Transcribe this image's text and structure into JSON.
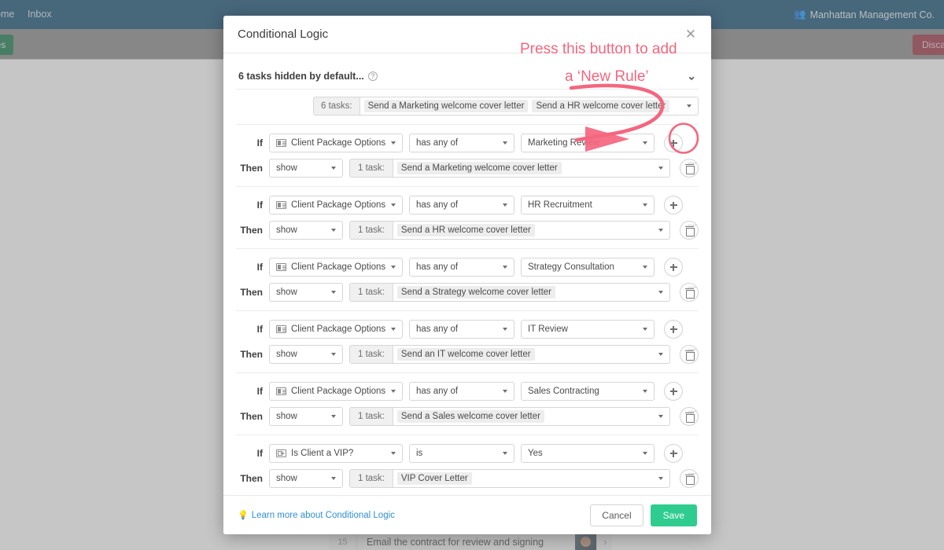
{
  "background": {
    "nav": {
      "home_label": "ome",
      "inbox_label": "Inbox",
      "org_label": "Manhattan Management Co.",
      "org_icon": "users-icon"
    },
    "subbar": {
      "green_button_label": "ges",
      "discard_button_label": "Discar"
    },
    "task_row": {
      "number": "15",
      "label": "Email the contract for review and signing",
      "chevron_icon": "chevron-right-icon",
      "avatar_icon": "avatar"
    }
  },
  "modal": {
    "title": "Conditional Logic",
    "close_icon": "close-icon",
    "section": {
      "title": "6 tasks hidden by default...",
      "help_icon": "help-circle-icon",
      "caret_icon": "chevron-down-icon"
    },
    "tasks_summary": {
      "count_label": "6 tasks:",
      "pills": [
        "Send a Marketing welcome cover letter",
        "Send a HR welcome cover letter"
      ],
      "caret_icon": "chevron-down-icon"
    },
    "labels": {
      "if": "If",
      "then": "Then",
      "add_icon": "plus-icon",
      "delete_icon": "trash-icon"
    },
    "rules": [
      {
        "field": "Client Package Options",
        "field_icon": "multi-select-field-icon",
        "operator": "has any of",
        "value": "Marketing Review",
        "action": "show",
        "task_count": "1 task:",
        "task": "Send a Marketing welcome cover letter"
      },
      {
        "field": "Client Package Options",
        "field_icon": "multi-select-field-icon",
        "operator": "has any of",
        "value": "HR Recruitment",
        "action": "show",
        "task_count": "1 task:",
        "task": "Send a HR welcome cover letter"
      },
      {
        "field": "Client Package Options",
        "field_icon": "multi-select-field-icon",
        "operator": "has any of",
        "value": "Strategy Consultation",
        "action": "show",
        "task_count": "1 task:",
        "task": "Send a Strategy welcome cover letter"
      },
      {
        "field": "Client Package Options",
        "field_icon": "multi-select-field-icon",
        "operator": "has any of",
        "value": "IT Review",
        "action": "show",
        "task_count": "1 task:",
        "task": "Send an IT welcome cover letter"
      },
      {
        "field": "Client Package Options",
        "field_icon": "multi-select-field-icon",
        "operator": "has any of",
        "value": "Sales Contracting",
        "action": "show",
        "task_count": "1 task:",
        "task": "Send a Sales welcome cover letter"
      },
      {
        "field": "Is Client a VIP?",
        "field_icon": "dropdown-field-icon",
        "operator": "is",
        "value": "Yes",
        "action": "show",
        "task_count": "1 task:",
        "task": "VIP Cover Letter"
      }
    ],
    "footer": {
      "learn_more_label": "Learn more about Conditional Logic",
      "learn_more_icon": "lightbulb-icon",
      "cancel_label": "Cancel",
      "save_label": "Save"
    }
  },
  "annotation": {
    "line1": "Press this button to add",
    "line2": "a ‘New Rule’",
    "color": "#f4667f"
  }
}
